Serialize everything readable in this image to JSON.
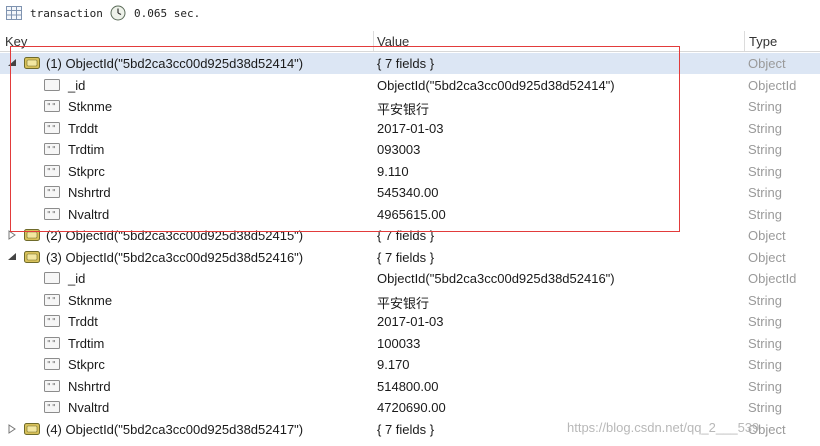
{
  "toolbar": {
    "collection": "transaction",
    "time": "0.065 sec."
  },
  "columns": {
    "key": "Key",
    "value": "Value",
    "type": "Type"
  },
  "documents": [
    {
      "key": "(1) ObjectId(\"5bd2ca3cc00d925d38d52414\")",
      "value": "{ 7 fields }",
      "type": "Object",
      "expanded": true,
      "fields": [
        {
          "key": "_id",
          "value": "ObjectId(\"5bd2ca3cc00d925d38d52414\")",
          "type": "ObjectId"
        },
        {
          "key": "Stknme",
          "value": "平安银行",
          "type": "String"
        },
        {
          "key": "Trddt",
          "value": "2017-01-03",
          "type": "String"
        },
        {
          "key": "Trdtim",
          "value": "093003",
          "type": "String"
        },
        {
          "key": "Stkprc",
          "value": "9.110",
          "type": "String"
        },
        {
          "key": "Nshrtrd",
          "value": "545340.00",
          "type": "String"
        },
        {
          "key": "Nvaltrd",
          "value": "4965615.00",
          "type": "String"
        }
      ]
    },
    {
      "key": "(2) ObjectId(\"5bd2ca3cc00d925d38d52415\")",
      "value": "{ 7 fields }",
      "type": "Object",
      "expanded": false,
      "fields": []
    },
    {
      "key": "(3) ObjectId(\"5bd2ca3cc00d925d38d52416\")",
      "value": "{ 7 fields }",
      "type": "Object",
      "expanded": true,
      "fields": [
        {
          "key": "_id",
          "value": "ObjectId(\"5bd2ca3cc00d925d38d52416\")",
          "type": "ObjectId"
        },
        {
          "key": "Stknme",
          "value": "平安银行",
          "type": "String"
        },
        {
          "key": "Trddt",
          "value": "2017-01-03",
          "type": "String"
        },
        {
          "key": "Trdtim",
          "value": "100033",
          "type": "String"
        },
        {
          "key": "Stkprc",
          "value": "9.170",
          "type": "String"
        },
        {
          "key": "Nshrtrd",
          "value": "514800.00",
          "type": "String"
        },
        {
          "key": "Nvaltrd",
          "value": "4720690.00",
          "type": "String"
        }
      ]
    },
    {
      "key": "(4) ObjectId(\"5bd2ca3cc00d925d38d52417\")",
      "value": "{ 7 fields }",
      "type": "Object",
      "expanded": false,
      "fields": []
    }
  ],
  "watermark": "https://blog.csdn.net/qq_2___539",
  "colors": {
    "selected_row": "#dce6f4",
    "highlight_box": "#e23b3b",
    "type_text": "#9a9a9a"
  }
}
